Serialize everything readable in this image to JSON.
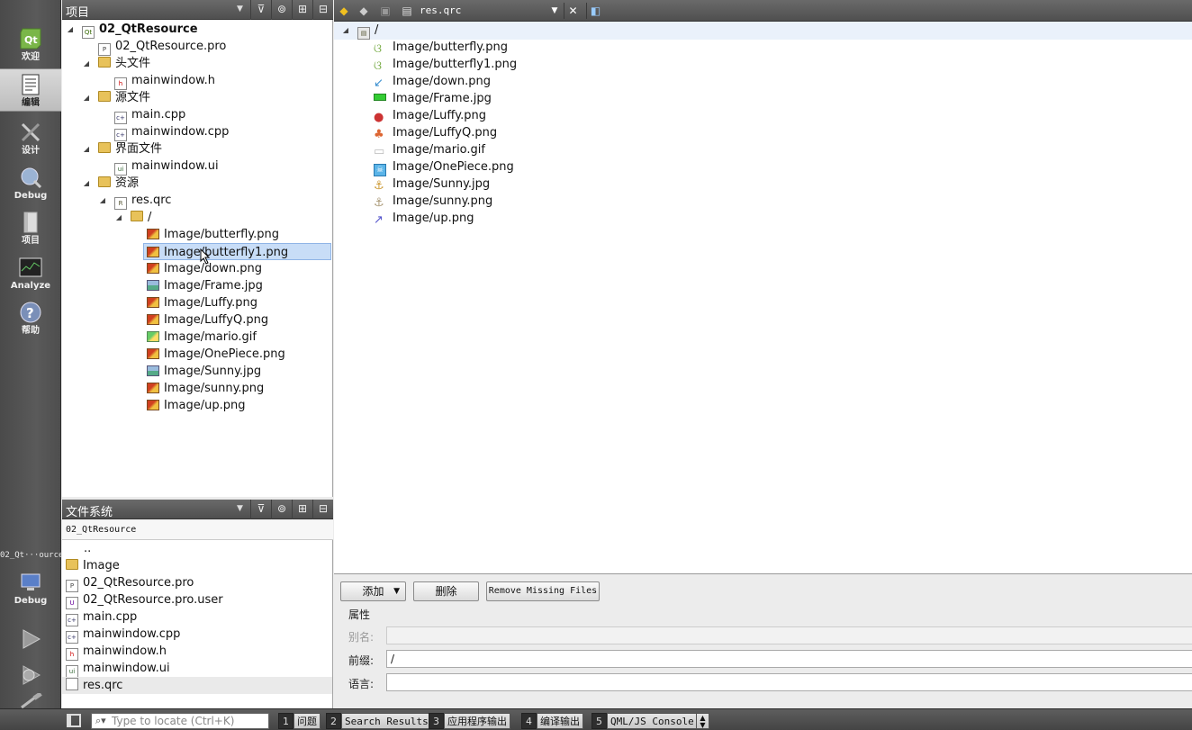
{
  "modes": [
    {
      "label": "欢迎",
      "icon": "qt-logo-icon"
    },
    {
      "label": "编辑",
      "icon": "edit-document-icon",
      "active": true
    },
    {
      "label": "设计",
      "icon": "design-tools-icon"
    },
    {
      "label": "Debug",
      "icon": "debug-bug-icon"
    },
    {
      "label": "项目",
      "icon": "project-book-icon"
    },
    {
      "label": "Analyze",
      "icon": "analyze-monitor-icon"
    },
    {
      "label": "帮助",
      "icon": "help-question-icon"
    }
  ],
  "kit": {
    "project_label": "02_Qt···ource",
    "mode_label": "Debug"
  },
  "project_panel": {
    "title": "项目",
    "tree": [
      {
        "label": "02_QtResource",
        "bold": true
      },
      {
        "label": "02_QtResource.pro"
      },
      {
        "label": "头文件"
      },
      {
        "label": "mainwindow.h"
      },
      {
        "label": "源文件"
      },
      {
        "label": "main.cpp"
      },
      {
        "label": "mainwindow.cpp"
      },
      {
        "label": "界面文件"
      },
      {
        "label": "mainwindow.ui"
      },
      {
        "label": "资源"
      },
      {
        "label": "res.qrc"
      },
      {
        "label": "/"
      },
      {
        "label": "Image/butterfly.png"
      },
      {
        "label": "Image/butterfly1.png",
        "selected": true
      },
      {
        "label": "Image/down.png"
      },
      {
        "label": "Image/Frame.jpg"
      },
      {
        "label": "Image/Luffy.png"
      },
      {
        "label": "Image/LuffyQ.png"
      },
      {
        "label": "Image/mario.gif"
      },
      {
        "label": "Image/OnePiece.png"
      },
      {
        "label": "Image/Sunny.jpg"
      },
      {
        "label": "Image/sunny.png"
      },
      {
        "label": "Image/up.png"
      }
    ]
  },
  "fs_panel": {
    "title": "文件系统",
    "path": "02_QtResource",
    "items": [
      "..",
      "Image",
      "02_QtResource.pro",
      "02_QtResource.pro.user",
      "main.cpp",
      "mainwindow.cpp",
      "mainwindow.h",
      "mainwindow.ui",
      "res.qrc"
    ]
  },
  "editor": {
    "document": "res.qrc",
    "root_prefix": "/",
    "resources": [
      "Image/butterfly.png",
      "Image/butterfly1.png",
      "Image/down.png",
      "Image/Frame.jpg",
      "Image/Luffy.png",
      "Image/LuffyQ.png",
      "Image/mario.gif",
      "Image/OnePiece.png",
      "Image/Sunny.jpg",
      "Image/sunny.png",
      "Image/up.png"
    ],
    "add_label": "添加",
    "remove_label": "删除",
    "remove_missing_label": "Remove Missing Files",
    "props_title": "属性",
    "alias_label": "别名:",
    "alias_value": "",
    "prefix_label": "前缀:",
    "prefix_value": "/",
    "lang_label": "语言:",
    "lang_value": ""
  },
  "statusbar": {
    "locate_placeholder": "Type to locate (Ctrl+K)",
    "tabs": [
      {
        "num": "1",
        "label": "问题"
      },
      {
        "num": "2",
        "label": "Search Results"
      },
      {
        "num": "3",
        "label": "应用程序输出"
      },
      {
        "num": "4",
        "label": "编译输出"
      },
      {
        "num": "5",
        "label": "QML/JS Console"
      }
    ]
  }
}
